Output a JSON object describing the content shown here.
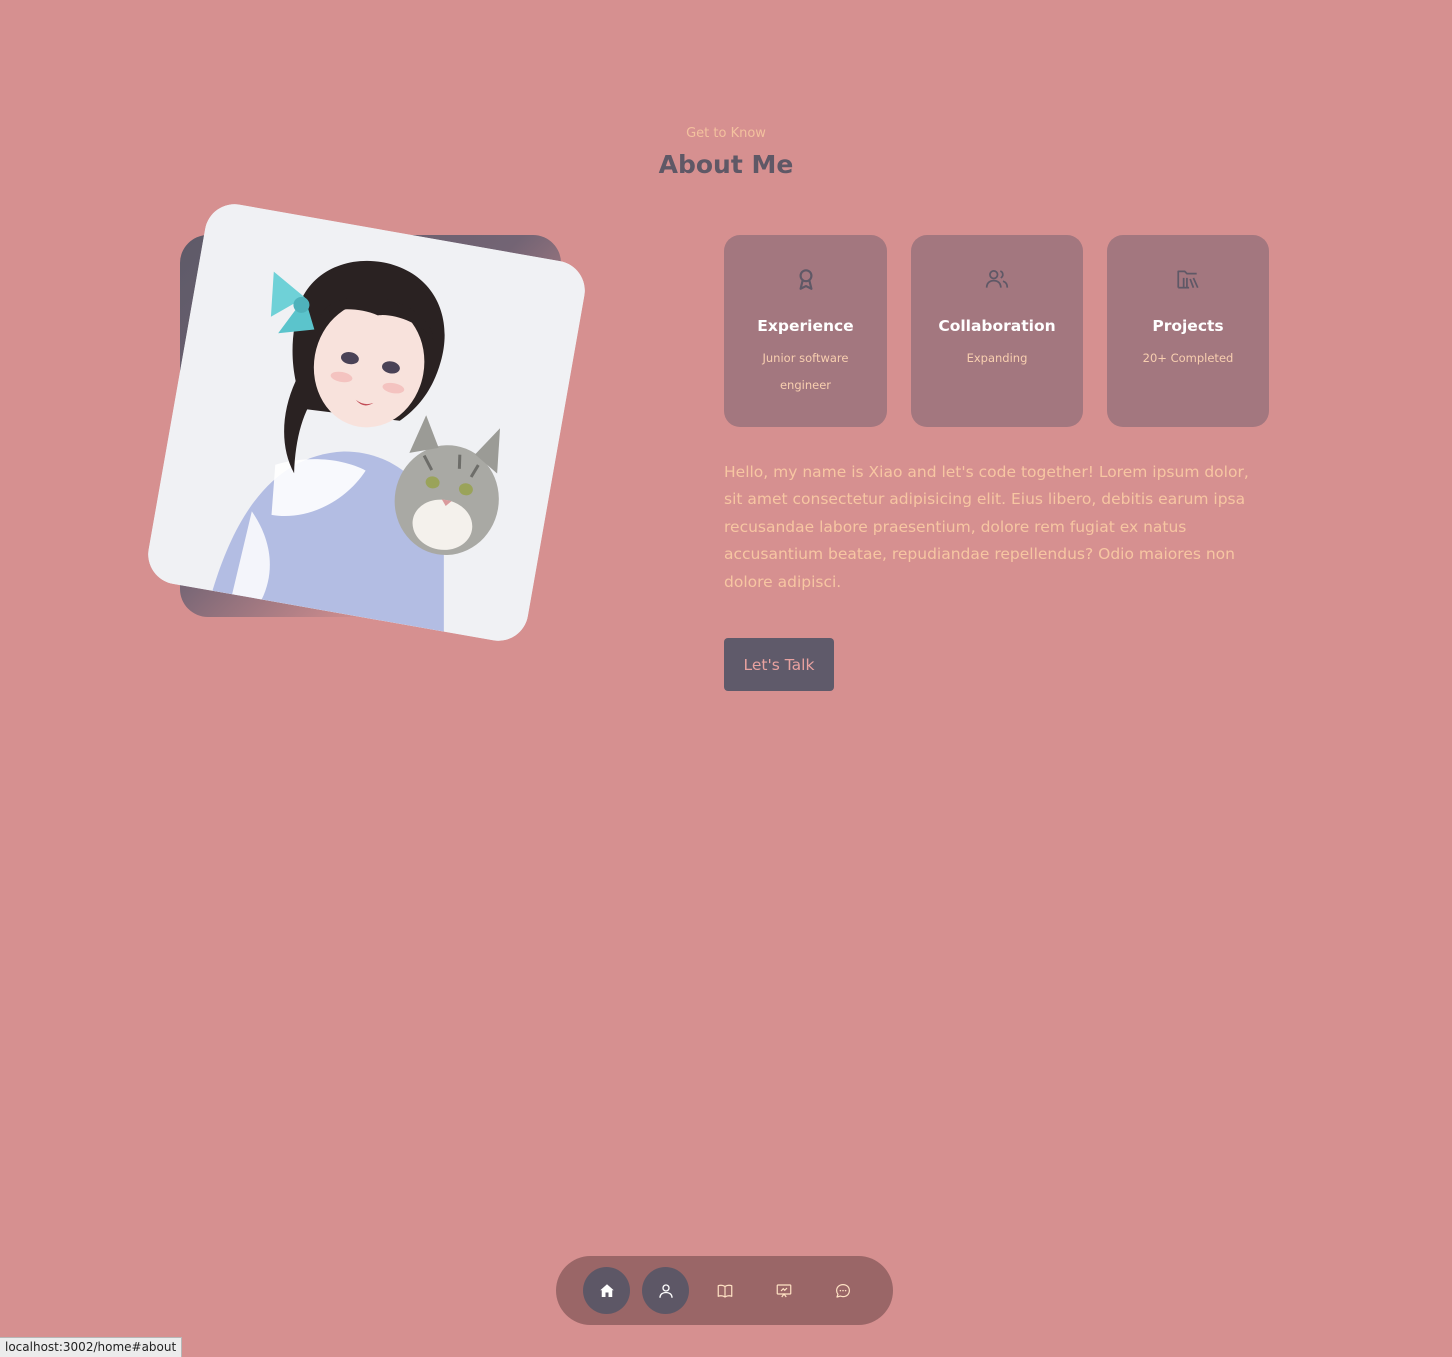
{
  "section": {
    "eyebrow": "Get to Know",
    "title": "About Me"
  },
  "stats": [
    {
      "title": "Experience",
      "subtitle": "Junior software engineer",
      "icon": "award-icon"
    },
    {
      "title": "Collaboration",
      "subtitle": "Expanding",
      "icon": "users-icon"
    },
    {
      "title": "Projects",
      "subtitle": "20+ Completed",
      "icon": "folder-library-icon"
    }
  ],
  "bio": "Hello, my name is Xiao and let's code together! Lorem ipsum dolor, sit amet consectetur adipisicing elit. Eius libero, debitis earum ipsa recusandae labore praesentium, dolore rem fugiat ex natus accusantium beatae, repudiandae repellendus? Odio maiores non dolore adipisci.",
  "cta_label": "Let's Talk",
  "nav": [
    {
      "icon": "home-icon",
      "active": true
    },
    {
      "icon": "user-icon",
      "active": true
    },
    {
      "icon": "book-icon",
      "active": false
    },
    {
      "icon": "presentation-icon",
      "active": false
    },
    {
      "icon": "message-icon",
      "active": false
    }
  ],
  "status_url": "localhost:3002/home#about",
  "colors": {
    "background": "#d69090",
    "accent_text": "#f3c19e",
    "heading": "#5f5866",
    "card": "#a3777f",
    "button": "#5f5a6a",
    "dock": "#9a6667"
  }
}
